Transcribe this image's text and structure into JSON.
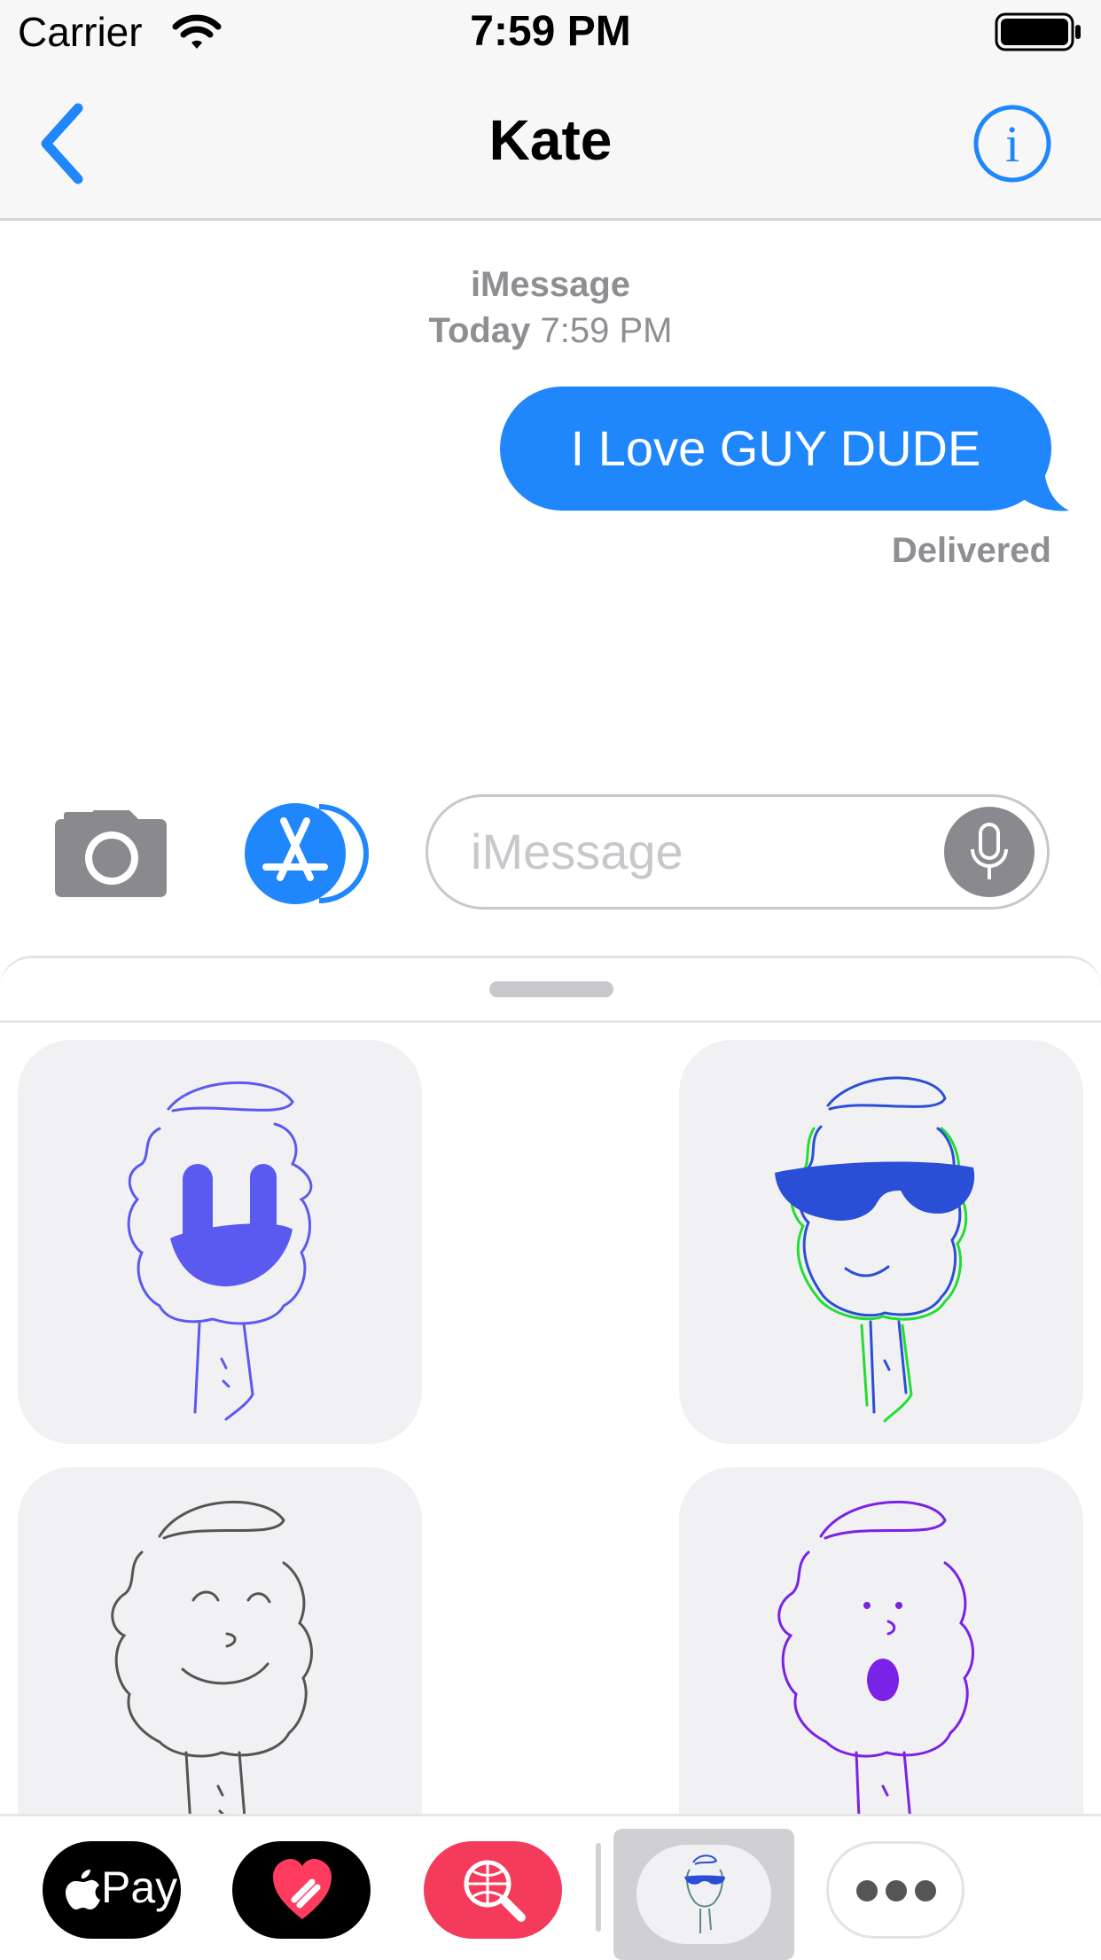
{
  "status_bar": {
    "carrier": "Carrier",
    "time": "7:59 PM"
  },
  "nav": {
    "contact_name": "Kate"
  },
  "conversation": {
    "service": "iMessage",
    "timestamp_day": "Today",
    "timestamp_time": "7:59 PM",
    "messages": [
      {
        "text": "I Love GUY DUDE",
        "direction": "outgoing"
      }
    ],
    "status": "Delivered"
  },
  "input": {
    "placeholder": "iMessage"
  },
  "app_strip": {
    "apple_pay_label": "Pay"
  },
  "colors": {
    "accent": "#1f86fb",
    "bubble": "#1f86fb",
    "secondary_text": "#8e8e93",
    "heart_app": "#ff3b5f",
    "search_app": "#ff3b5f"
  },
  "icons": [
    "back-chevron-icon",
    "info-icon",
    "wifi-icon",
    "battery-icon",
    "camera-icon",
    "app-store-icon",
    "microphone-icon",
    "apple-icon",
    "heart-icon",
    "globe-search-icon",
    "more-dots-icon"
  ]
}
